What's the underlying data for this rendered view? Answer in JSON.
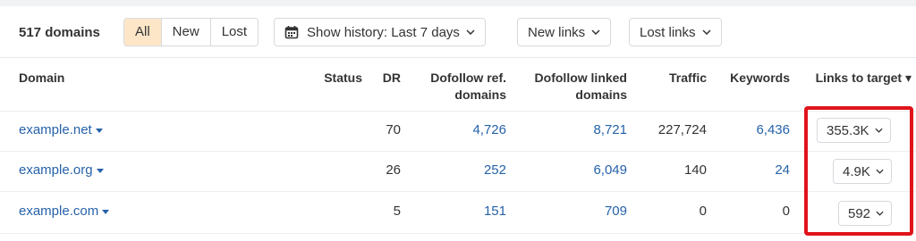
{
  "summary": {
    "count_label": "517 domains"
  },
  "filters": {
    "segments": [
      {
        "label": "All",
        "active": true
      },
      {
        "label": "New",
        "active": false
      },
      {
        "label": "Lost",
        "active": false
      }
    ],
    "history_label": "Show history: Last 7 days",
    "new_links_label": "New links",
    "lost_links_label": "Lost links"
  },
  "table": {
    "columns": {
      "domain": "Domain",
      "status": "Status",
      "dr": "DR",
      "dofollow_ref_1": "Dofollow ref.",
      "dofollow_ref_2": "domains",
      "dofollow_linked_1": "Dofollow linked",
      "dofollow_linked_2": "domains",
      "traffic": "Traffic",
      "keywords": "Keywords",
      "links_to_target": "Links to target ▾"
    },
    "rows": [
      {
        "domain": "example.net",
        "status": "",
        "dr": "70",
        "dofollow_ref": "4,726",
        "dofollow_linked": "8,721",
        "traffic": "227,724",
        "keywords": "6,436",
        "links_to_target": "355.3K"
      },
      {
        "domain": "example.org",
        "status": "",
        "dr": "26",
        "dofollow_ref": "252",
        "dofollow_linked": "6,049",
        "traffic": "140",
        "keywords": "24",
        "links_to_target": "4.9K"
      },
      {
        "domain": "example.com",
        "status": "",
        "dr": "5",
        "dofollow_ref": "151",
        "dofollow_linked": "709",
        "traffic": "0",
        "keywords": "0",
        "links_to_target": "592"
      }
    ]
  },
  "colors": {
    "link": "#2562a8",
    "active_segment": "#fde6c8",
    "highlight": "#e0131b"
  },
  "icons": {
    "calendar": "calendar-icon",
    "chevron": "chevron-down-icon",
    "caret": "caret-down-icon"
  }
}
